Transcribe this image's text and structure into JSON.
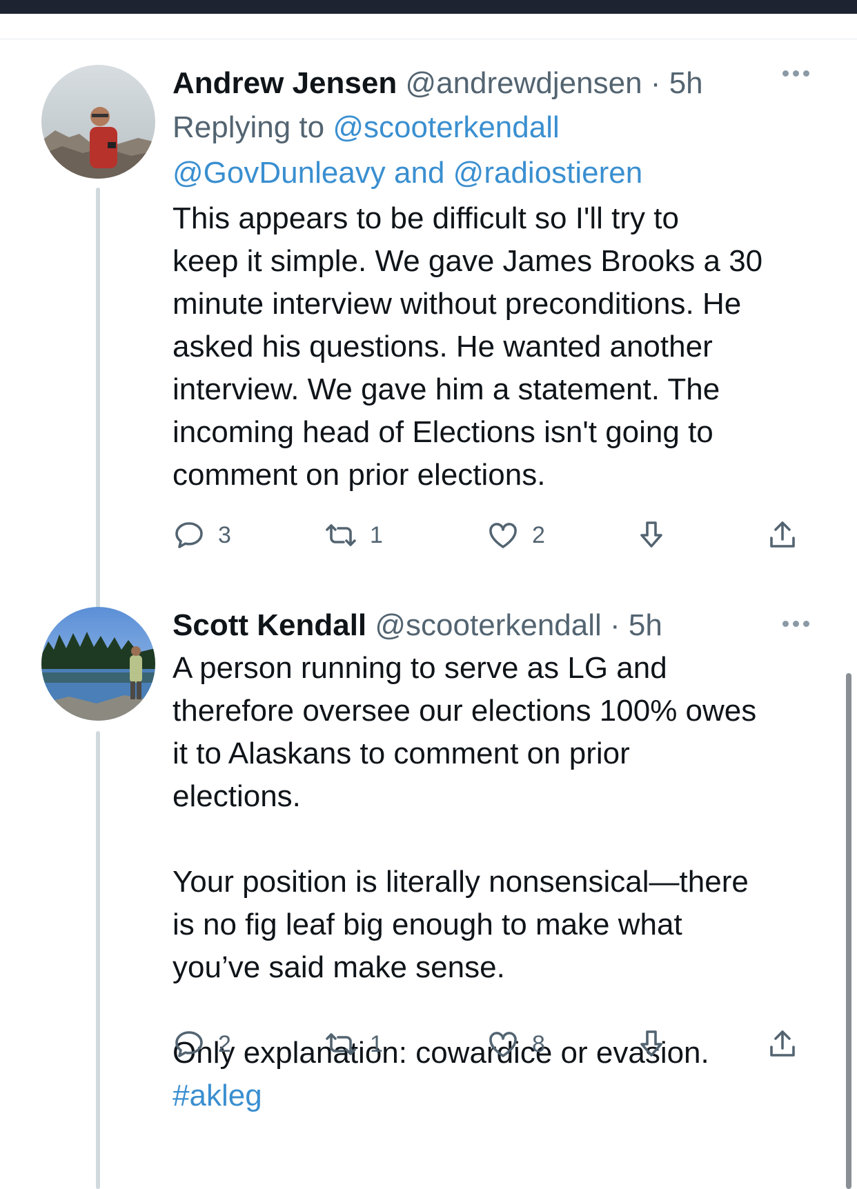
{
  "tweets": [
    {
      "name": "Andrew Jensen",
      "handle": "@andrewdjensen",
      "separator": "·",
      "time": "5h",
      "replying_prefix": "Replying to ",
      "replying_users": [
        "@scooterkendall",
        "@GovDunleavy",
        "@radiostieren"
      ],
      "replying_and": " and ",
      "text_lines": [
        "This appears to be difficult so I'll try to",
        "keep it simple. We gave James Brooks a 30",
        "minute interview without preconditions. He",
        "asked his questions. He wanted another",
        "interview. We gave him a statement. The",
        "incoming head of Elections isn't going to",
        "comment on prior elections."
      ],
      "counts": {
        "replies": "3",
        "retweets": "1",
        "likes": "2"
      }
    },
    {
      "name": "Scott Kendall",
      "handle": "@scooterkendall",
      "separator": "·",
      "time": "5h",
      "text_lines": [
        "A person running to serve as LG and",
        "therefore oversee our elections 100% owes",
        "it to Alaskans to comment on prior",
        "elections."
      ],
      "text_lines_2": [
        "Your position is literally nonsensical—there",
        "is no fig leaf big enough to make what",
        "you’ve said make sense."
      ],
      "text_line_3": "Only explanation: cowardice or evasion.",
      "hashtag": "#akleg",
      "counts": {
        "replies": "2",
        "retweets": "1",
        "likes": "8"
      }
    }
  ],
  "icons": {
    "reply": "reply-icon",
    "retweet": "retweet-icon",
    "like": "heart-icon",
    "downvote": "arrow-down-icon",
    "share": "share-icon",
    "more": "more-icon"
  },
  "colors": {
    "link": "#3a8fd0",
    "secondary": "#536471",
    "icon": "#536471",
    "top_bar": "#1d2330"
  }
}
